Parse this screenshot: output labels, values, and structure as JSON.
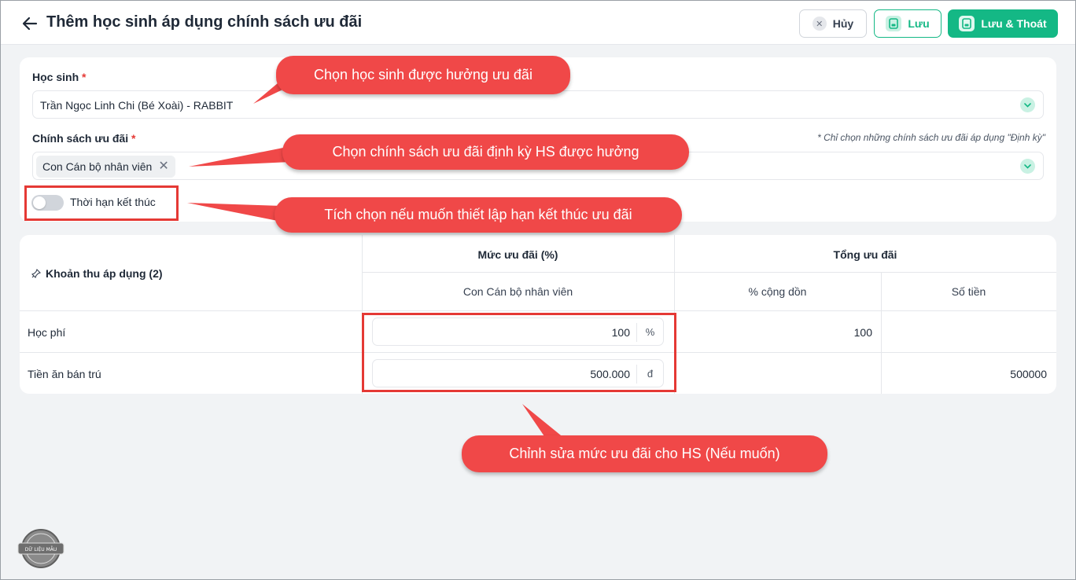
{
  "header": {
    "title": "Thêm học sinh áp dụng chính sách ưu đãi",
    "buttons": {
      "cancel": "Hủy",
      "save": "Lưu",
      "save_exit": "Lưu & Thoát"
    }
  },
  "form": {
    "student": {
      "label": "Học sinh",
      "required_mark": "*",
      "value": "Trần Ngọc Linh Chi (Bé Xoài) - RABBIT"
    },
    "policy": {
      "label": "Chính sách ưu đãi",
      "required_mark": "*",
      "hint": "* Chỉ chọn những chính sách ưu đãi áp dụng \"Định kỳ\"",
      "chips": [
        "Con Cán bộ nhân viên"
      ]
    },
    "end_date_toggle": {
      "label": "Thời hạn kết thúc",
      "checked": false
    }
  },
  "table": {
    "fees_header": "Khoản thu áp dụng (2)",
    "discount_header": "Mức ưu đãi (%)",
    "discount_sub": "Con Cán bộ nhân viên",
    "total_header": "Tổng ưu đãi",
    "total_sub_percent": "% cộng dồn",
    "total_sub_amount": "Số tiền",
    "rows": [
      {
        "name": "Học phí",
        "value": "100",
        "unit": "%",
        "percent_total": "100",
        "amount_total": ""
      },
      {
        "name": "Tiền ăn bán trú",
        "value": "500.000",
        "unit": "đ",
        "percent_total": "",
        "amount_total": "500000"
      }
    ]
  },
  "callouts": {
    "student": "Chọn học sinh được hưởng ưu đãi",
    "policy": "Chọn chính sách ưu đãi định kỳ HS được hưởng",
    "toggle": "Tích chọn nếu muốn thiết lập hạn kết thúc ưu đãi",
    "discount": "Chỉnh sửa mức ưu đãi cho HS (Nếu muốn)"
  },
  "watermark": {
    "text": "DỮ LIỆU MẪU"
  },
  "colors": {
    "primary": "#14b885",
    "callout": "#f04848",
    "highlight": "#e53935"
  }
}
